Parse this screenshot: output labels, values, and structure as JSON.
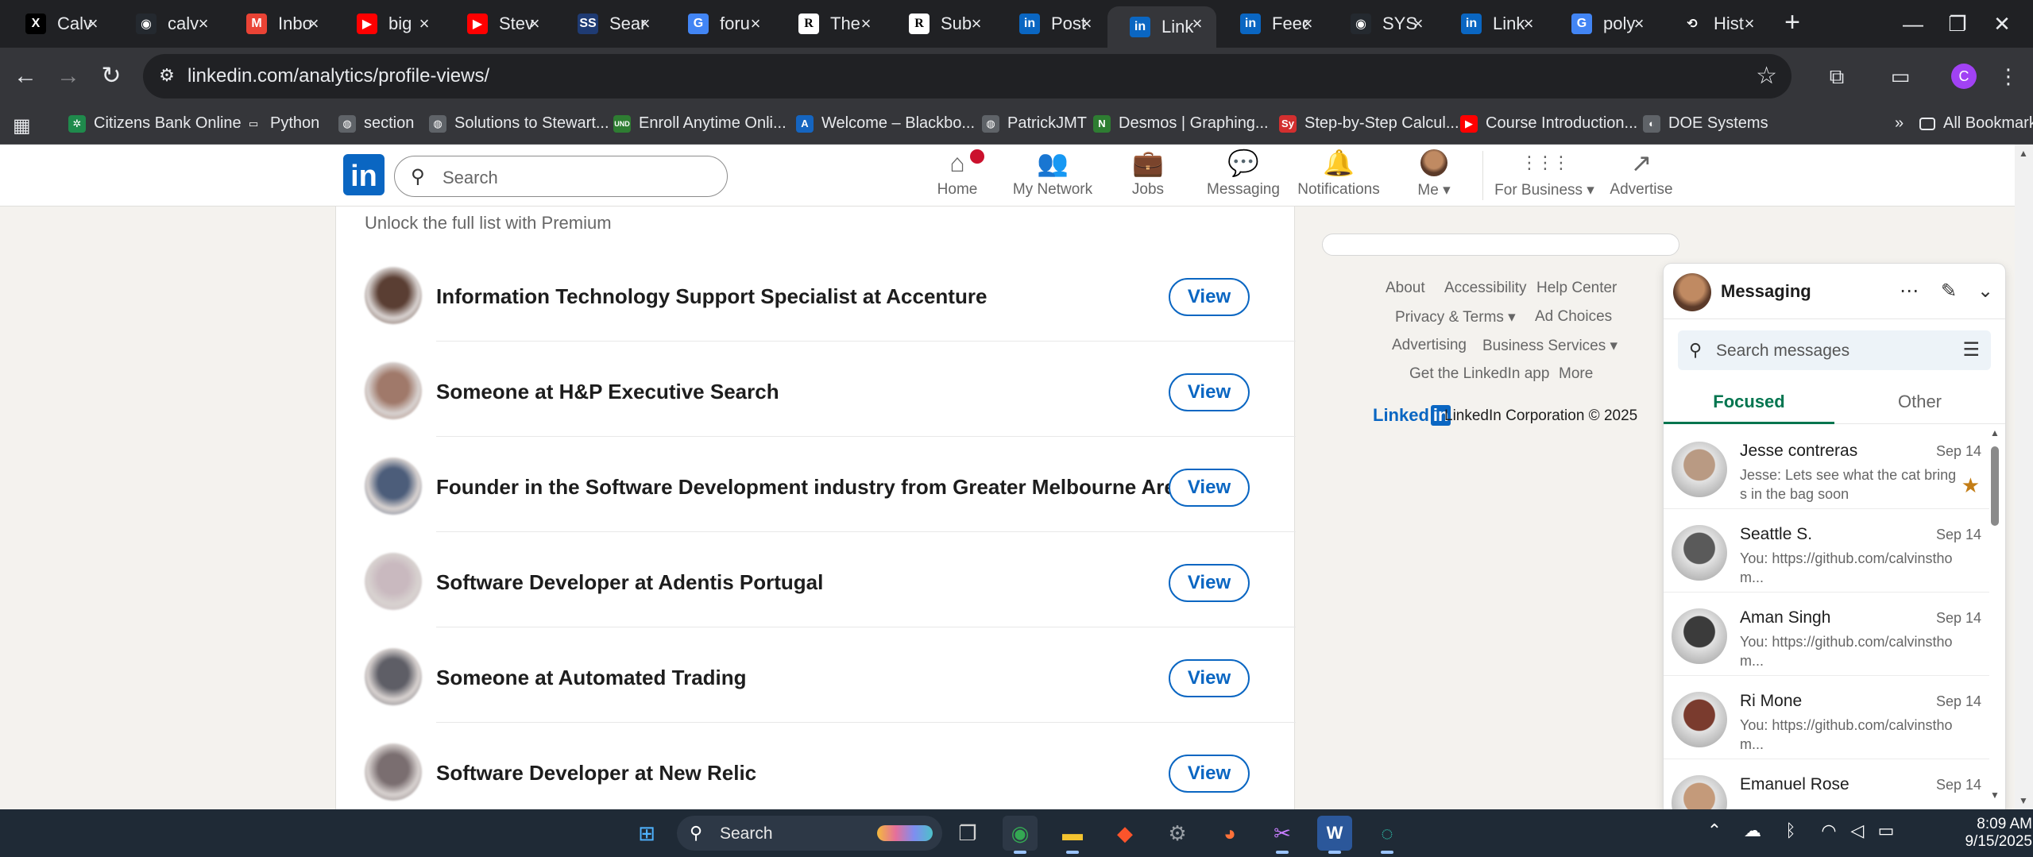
{
  "browser": {
    "tabs": [
      {
        "title": "Calv",
        "icon": "x-icon",
        "color": "#000000",
        "glyph": "X"
      },
      {
        "title": "calv",
        "icon": "github-icon",
        "color": "#24292f",
        "glyph": "◉"
      },
      {
        "title": "Inbo",
        "icon": "gmail-icon",
        "color": "#ea4335",
        "glyph": "M"
      },
      {
        "title": "big",
        "icon": "youtube-icon",
        "color": "#ff0000",
        "glyph": "▶"
      },
      {
        "title": "Stev",
        "icon": "youtube-icon",
        "color": "#ff0000",
        "glyph": "▶"
      },
      {
        "title": "Sear",
        "icon": "ssrn-icon",
        "color": "#1f3b73",
        "glyph": "SS"
      },
      {
        "title": "foru",
        "icon": "google-icon",
        "color": "#4285f4",
        "glyph": "G"
      },
      {
        "title": "The",
        "icon": "researchgate-icon",
        "color": "#ffffff",
        "glyph": "R"
      },
      {
        "title": "Sub",
        "icon": "researchgate-icon",
        "color": "#ffffff",
        "glyph": "R"
      },
      {
        "title": "Post",
        "icon": "linkedin-icon",
        "color": "#0a66c2",
        "glyph": "in"
      },
      {
        "title": "Link",
        "icon": "linkedin-icon",
        "color": "#0a66c2",
        "glyph": "in"
      },
      {
        "title": "Feed",
        "icon": "linkedin-icon",
        "color": "#0a66c2",
        "glyph": "in"
      },
      {
        "title": "SYS",
        "icon": "github-icon",
        "color": "#24292f",
        "glyph": "◉"
      },
      {
        "title": "Link",
        "icon": "linkedin-icon",
        "color": "#0a66c2",
        "glyph": "in"
      },
      {
        "title": "poly",
        "icon": "google-icon",
        "color": "#4285f4",
        "glyph": "G"
      },
      {
        "title": "Hist",
        "icon": "history-icon",
        "color": "#202124",
        "glyph": "⟲"
      }
    ],
    "active_tab_index": 10,
    "url": "linkedin.com/analytics/profile-views/",
    "profile_initial": "C",
    "bookmarks": [
      {
        "label": "Citizens Bank Online",
        "icon": "citizens-icon",
        "color": "#1f8a4c",
        "glyph": "✲"
      },
      {
        "label": "Python",
        "icon": "folder-icon",
        "color": "#35363a",
        "glyph": "▭"
      },
      {
        "label": "section",
        "icon": "globe-icon",
        "color": "#5f6368",
        "glyph": "◍"
      },
      {
        "label": "Solutions to Stewart...",
        "icon": "globe-icon",
        "color": "#5f6368",
        "glyph": "◍"
      },
      {
        "label": "Enroll Anytime Onli...",
        "icon": "und-icon",
        "color": "#2e7d32",
        "glyph": "UND"
      },
      {
        "label": "Welcome – Blackbo...",
        "icon": "blackboard-icon",
        "color": "#1565c0",
        "glyph": "A"
      },
      {
        "label": "PatrickJMT",
        "icon": "globe-icon",
        "color": "#5f6368",
        "glyph": "◍"
      },
      {
        "label": "Desmos | Graphing...",
        "icon": "desmos-icon",
        "color": "#2e7d32",
        "glyph": "N"
      },
      {
        "label": "Step-by-Step Calcul...",
        "icon": "symbolab-icon",
        "color": "#d32f2f",
        "glyph": "Sy"
      },
      {
        "label": "Course Introduction...",
        "icon": "youtube-icon",
        "color": "#ff0000",
        "glyph": "▶"
      },
      {
        "label": "DOE Systems",
        "icon": "doe-icon",
        "color": "#5f6368",
        "glyph": "◐"
      }
    ],
    "all_bookmarks_label": "All Bookmarks"
  },
  "linkedin": {
    "search_placeholder": "Search",
    "nav": [
      {
        "label": "Home",
        "icon": "home-icon",
        "glyph": "⌂",
        "badge": true
      },
      {
        "label": "My Network",
        "icon": "network-icon",
        "glyph": "👥",
        "badge": false
      },
      {
        "label": "Jobs",
        "icon": "briefcase-icon",
        "glyph": "💼",
        "badge": false
      },
      {
        "label": "Messaging",
        "icon": "messaging-icon",
        "glyph": "💬",
        "badge": false
      },
      {
        "label": "Notifications",
        "icon": "bell-icon",
        "glyph": "🔔",
        "badge": false
      },
      {
        "label": "Me ▾",
        "icon": "me-avatar",
        "glyph": "",
        "badge": false
      },
      {
        "label": "For Business ▾",
        "icon": "grid-icon",
        "glyph": "⋮⋮⋮",
        "badge": false
      },
      {
        "label": "Advertise",
        "icon": "advertise-icon",
        "glyph": "↗",
        "badge": false
      }
    ],
    "unlock_text": "Unlock the full list with Premium",
    "viewers": [
      {
        "title": "Information Technology Support Specialist at Accenture",
        "button": "View",
        "avatar_color": "#5a3e33"
      },
      {
        "title": "Someone at H&P Executive Search",
        "button": "View",
        "avatar_color": "#a0796a"
      },
      {
        "title": "Founder in the Software Development industry from Greater Melbourne Area",
        "button": "View",
        "avatar_color": "#4c5d7a"
      },
      {
        "title": "Software Developer at Adentis Portugal",
        "button": "View",
        "avatar_color": "#c9b9bf"
      },
      {
        "title": "Someone at Automated Trading",
        "button": "View",
        "avatar_color": "#5e5e66"
      },
      {
        "title": "Software Developer at New Relic",
        "button": "View",
        "avatar_color": "#7a6e70"
      }
    ],
    "footer": {
      "links": [
        "About",
        "Accessibility",
        "Help Center",
        "Privacy & Terms ▾",
        "Ad Choices",
        "Advertising",
        "Business Services ▾",
        "Get the LinkedIn app",
        "More"
      ],
      "brand_word": "Linked",
      "brand_box": "in",
      "copyright": "LinkedIn Corporation © 2025"
    }
  },
  "messaging": {
    "title": "Messaging",
    "search_placeholder": "Search messages",
    "tabs": [
      "Focused",
      "Other"
    ],
    "conversations": [
      {
        "name": "Jesse contreras",
        "date": "Sep 14",
        "snippet": "Jesse: Lets see what the cat brings in the bag soon",
        "starred": true,
        "avatar_color": "#b99a83"
      },
      {
        "name": "Seattle S.",
        "date": "Sep 14",
        "snippet": "You: https://github.com/calvinsthom...",
        "starred": false,
        "avatar_color": "#5a5a5a"
      },
      {
        "name": "Aman Singh",
        "date": "Sep 14",
        "snippet": "You: https://github.com/calvinsthom...",
        "starred": false,
        "avatar_color": "#3b3b3b"
      },
      {
        "name": "Ri Mone",
        "date": "Sep 14",
        "snippet": "You: https://github.com/calvinsthom...",
        "starred": false,
        "avatar_color": "#7a3b2e"
      },
      {
        "name": "Emanuel Rose",
        "date": "Sep 14",
        "snippet": "",
        "starred": false,
        "avatar_color": "#c49a7a"
      }
    ]
  },
  "taskbar": {
    "search_placeholder": "Search",
    "apps": [
      {
        "name": "start-icon",
        "glyph": "⊞",
        "color": "#4fb3ff"
      },
      {
        "name": "task-view-icon",
        "glyph": "❐",
        "color": "#d0d0d0"
      },
      {
        "name": "chrome-icon",
        "glyph": "◉",
        "color": "#34a853"
      },
      {
        "name": "file-explorer-icon",
        "glyph": "▬",
        "color": "#f4c430"
      },
      {
        "name": "brave-icon",
        "glyph": "◆",
        "color": "#fb542b"
      },
      {
        "name": "settings-icon",
        "glyph": "⚙",
        "color": "#9aa0a6"
      },
      {
        "name": "firefox-icon",
        "glyph": "◕",
        "color": "#ff7139"
      },
      {
        "name": "snipping-tool-icon",
        "glyph": "✂",
        "color": "#c77dff"
      },
      {
        "name": "word-icon",
        "glyph": "W",
        "color": "#2b579a"
      },
      {
        "name": "edge-icon",
        "glyph": "◌",
        "color": "#2ec7b0"
      }
    ],
    "time": "8:09 AM",
    "date": "9/15/2025"
  }
}
